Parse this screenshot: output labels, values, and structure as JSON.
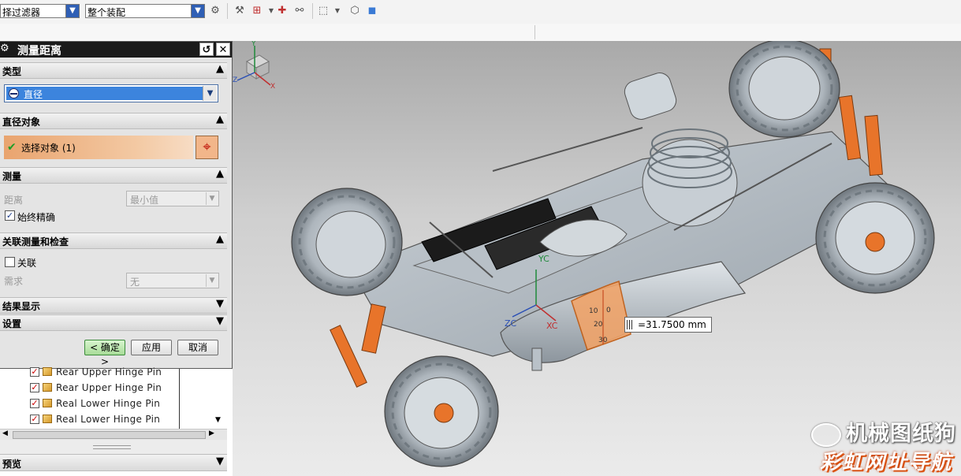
{
  "toolbar": {
    "filter_combo": "择过滤器",
    "assembly_combo": "整个装配"
  },
  "dialog": {
    "title": "测量距离",
    "reset_icon": "reset-icon",
    "close_icon": "close-icon",
    "sections": {
      "type": "类型",
      "diameter_object": "直径对象",
      "measure": "测量",
      "associative": "关联测量和检查",
      "result_display": "结果显示",
      "settings": "设置"
    },
    "type_value": "直径",
    "select_object": "选择对象 (1)",
    "distance_label": "距离",
    "distance_value": "最小值",
    "always_accurate_label": "始终精确",
    "always_accurate_checked": true,
    "associative_label": "关联",
    "associative_checked": false,
    "requirement_label": "需求",
    "requirement_value": "无",
    "ok_label": "< 确定 >",
    "apply_label": "应用",
    "cancel_label": "取消"
  },
  "tree": {
    "items": [
      {
        "label": "Rear Upper Hinge Pin"
      },
      {
        "label": "Rear Upper Hinge Pin"
      },
      {
        "label": "Real Lower Hinge Pin"
      },
      {
        "label": "Real Lower Hinge Pin"
      }
    ]
  },
  "preview_label": "预览",
  "viewport": {
    "measurement": "=31.7500 mm",
    "axis_labels": {
      "yc": "YC",
      "xc": "XC",
      "zc": "ZC"
    },
    "scale_ticks": [
      "0",
      "10",
      "20",
      "30"
    ],
    "triad_labels": {
      "y": "Y",
      "x": "X",
      "z": "Z"
    },
    "watermark_line1": "机械图纸狗",
    "watermark_line2": "彩虹网址导航"
  },
  "colors": {
    "accent_orange": "#e8742a",
    "selection_blue": "#3c84dd",
    "dialog_title_bg": "#1a1a1a"
  }
}
